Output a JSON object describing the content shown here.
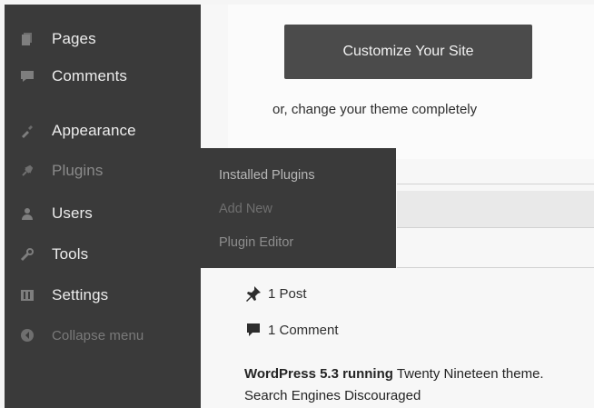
{
  "sidebar": {
    "items": [
      {
        "label": "Pages",
        "icon": "pages-icon"
      },
      {
        "label": "Comments",
        "icon": "comments-icon"
      },
      {
        "label": "Appearance",
        "icon": "appearance-icon"
      },
      {
        "label": "Plugins",
        "icon": "plugins-icon"
      },
      {
        "label": "Users",
        "icon": "users-icon"
      },
      {
        "label": "Tools",
        "icon": "tools-icon"
      },
      {
        "label": "Settings",
        "icon": "settings-icon"
      },
      {
        "label": "Collapse menu",
        "icon": "collapse-icon"
      }
    ]
  },
  "flyout": {
    "items": [
      "Installed Plugins",
      "Add New",
      "Plugin Editor"
    ]
  },
  "main": {
    "customize_label": "Customize Your Site",
    "theme_link": "or, change your theme completely",
    "glance": {
      "posts": "1 Post",
      "comments": "1 Comment"
    },
    "version_text_bold": "WordPress 5.3 running",
    "theme_name": " Twenty Nineteen",
    "theme_suffix": " theme.",
    "search_engines": "Search Engines Discouraged"
  },
  "colors": {
    "sidebar_bg": "#3a3a3a",
    "button_bg": "#4b4b4b",
    "page_bg": "#f7f7f7"
  }
}
